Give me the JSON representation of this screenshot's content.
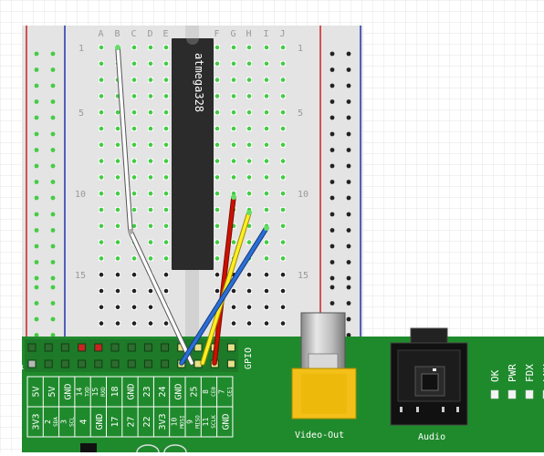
{
  "breadboard": {
    "column_letters_left": [
      "A",
      "B",
      "C",
      "D",
      "E"
    ],
    "column_letters_right": [
      "F",
      "G",
      "H",
      "I",
      "J"
    ],
    "row_numbers": [
      "1",
      "5",
      "10",
      "15"
    ]
  },
  "chip": {
    "label": "atmega328"
  },
  "pi": {
    "gpio_label": "GPIO",
    "header_pin1": "1",
    "header_top_labels": [
      "5V",
      "5V",
      "GND",
      "14\nTXD",
      "15\nRXD",
      "18",
      "GND",
      "23",
      "24",
      "GND",
      "25",
      "8\nCE0",
      "7\nCE1"
    ],
    "header_bottom_labels": [
      "3V3",
      "2\nSDA",
      "3\nSCL",
      "4",
      "GND",
      "17",
      "27",
      "22",
      "3V3",
      "10\nMOSI",
      "9\nMISO",
      "11\nSCLK",
      "GND"
    ],
    "video_label": "Video-Out",
    "audio_label": "Audio",
    "leds": [
      "OK",
      "PWR",
      "FDX",
      "LNK"
    ]
  },
  "wires": [
    {
      "name": "white-wire",
      "color": "#ffffff"
    },
    {
      "name": "red-wire",
      "color": "#cc1100"
    },
    {
      "name": "yellow-wire",
      "color": "#ffee22"
    },
    {
      "name": "blue-wire",
      "color": "#2a6fd6"
    }
  ],
  "colors": {
    "board_green": "#1f8a2c",
    "breadboard": "#e4e4e4",
    "chip": "#2b2b2b",
    "rail_red": "#cc2222",
    "rail_blue": "#2233aa",
    "video_yellow": "#f3c019"
  }
}
